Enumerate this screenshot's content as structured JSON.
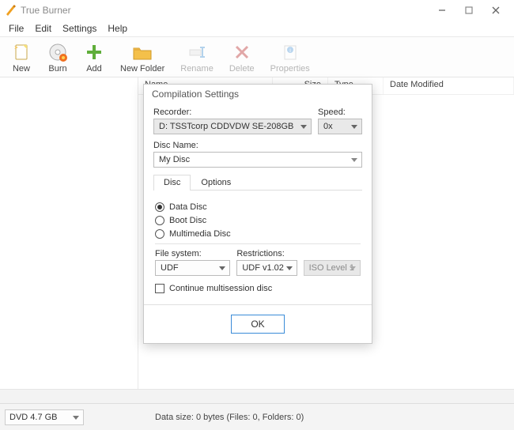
{
  "app": {
    "title": "True Burner"
  },
  "menu": {
    "file": "File",
    "edit": "Edit",
    "settings": "Settings",
    "help": "Help"
  },
  "toolbar": {
    "new": "New",
    "burn": "Burn",
    "add": "Add",
    "new_folder": "New Folder",
    "rename": "Rename",
    "delete": "Delete",
    "properties": "Properties"
  },
  "list": {
    "cols": {
      "name": "Name",
      "size": "Size",
      "type": "Type",
      "date": "Date Modified"
    }
  },
  "status": {
    "disc_type": "DVD 4.7 GB",
    "data_size": "Data size: 0 bytes (Files: 0, Folders: 0)"
  },
  "dialog": {
    "title": "Compilation Settings",
    "recorder_lbl": "Recorder:",
    "recorder_val": "D: TSSTcorp CDDVDW SE-208GB",
    "speed_lbl": "Speed:",
    "speed_val": "0x",
    "disc_name_lbl": "Disc Name:",
    "disc_name_val": "My Disc",
    "tabs": {
      "disc": "Disc",
      "options": "Options"
    },
    "radios": {
      "data": "Data Disc",
      "boot": "Boot Disc",
      "multi": "Multimedia Disc"
    },
    "fs_lbl": "File system:",
    "fs_val": "UDF",
    "restr_lbl": "Restrictions:",
    "restr_val": "UDF v1.02",
    "iso_val": "ISO Level 1",
    "continue_lbl": "Continue multisession disc",
    "ok": "OK"
  }
}
